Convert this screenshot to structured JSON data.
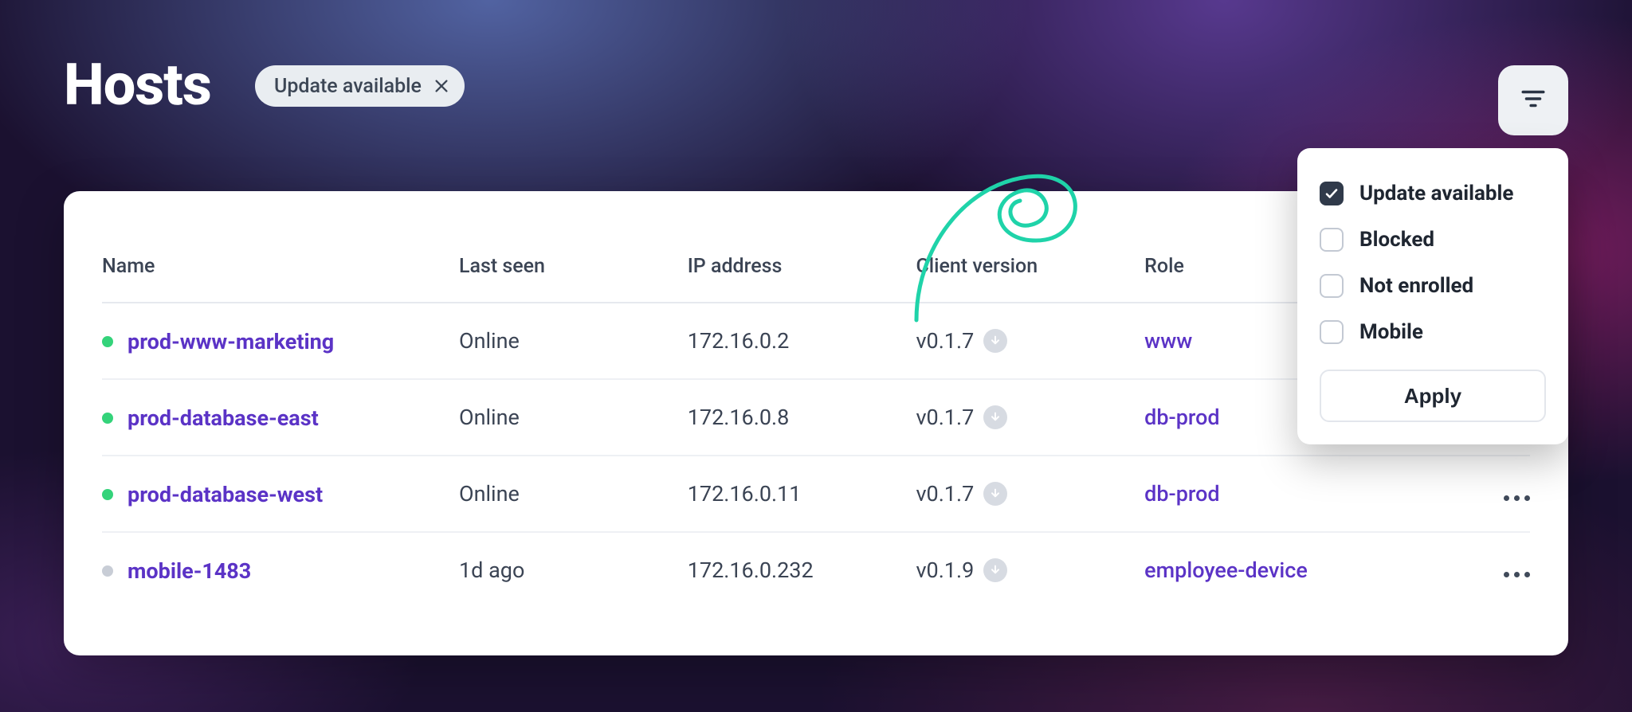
{
  "page": {
    "title": "Hosts"
  },
  "chip": {
    "label": "Update available"
  },
  "columns": {
    "name": "Name",
    "last_seen": "Last seen",
    "ip": "IP address",
    "version": "Client version",
    "role": "Role"
  },
  "rows": [
    {
      "status": "online",
      "name": "prod-www-marketing",
      "last_seen": "Online",
      "ip": "172.16.0.2",
      "version": "v0.1.7",
      "role": "www"
    },
    {
      "status": "online",
      "name": "prod-database-east",
      "last_seen": "Online",
      "ip": "172.16.0.8",
      "version": "v0.1.7",
      "role": "db-prod"
    },
    {
      "status": "online",
      "name": "prod-database-west",
      "last_seen": "Online",
      "ip": "172.16.0.11",
      "version": "v0.1.7",
      "role": "db-prod"
    },
    {
      "status": "offline",
      "name": "mobile-1483",
      "last_seen": "1d ago",
      "ip": "172.16.0.232",
      "version": "v0.1.9",
      "role": "employee-device"
    }
  ],
  "filter": {
    "options": [
      {
        "label": "Update available",
        "checked": true
      },
      {
        "label": "Blocked",
        "checked": false
      },
      {
        "label": "Not enrolled",
        "checked": false
      },
      {
        "label": "Mobile",
        "checked": false
      }
    ],
    "apply_label": "Apply"
  },
  "colors": {
    "accent_purple": "#5b33c6",
    "online_green": "#34d37a",
    "scribble_teal": "#1fd3a9"
  }
}
